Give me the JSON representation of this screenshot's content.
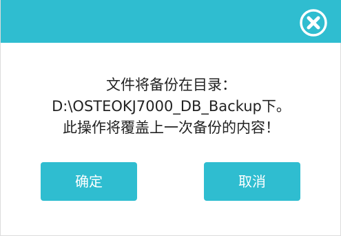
{
  "dialog": {
    "close_icon": "close-circle-icon",
    "message_lines": [
      "文件将备份在目录：",
      "D:\\OSTEOKJ7000_DB_Backup下。",
      "此操作将覆盖上一次备份的内容！"
    ],
    "confirm_label": "确定",
    "cancel_label": "取消"
  },
  "colors": {
    "accent": "#2fbdd0",
    "text": "#222222",
    "button_text": "#ffffff"
  }
}
